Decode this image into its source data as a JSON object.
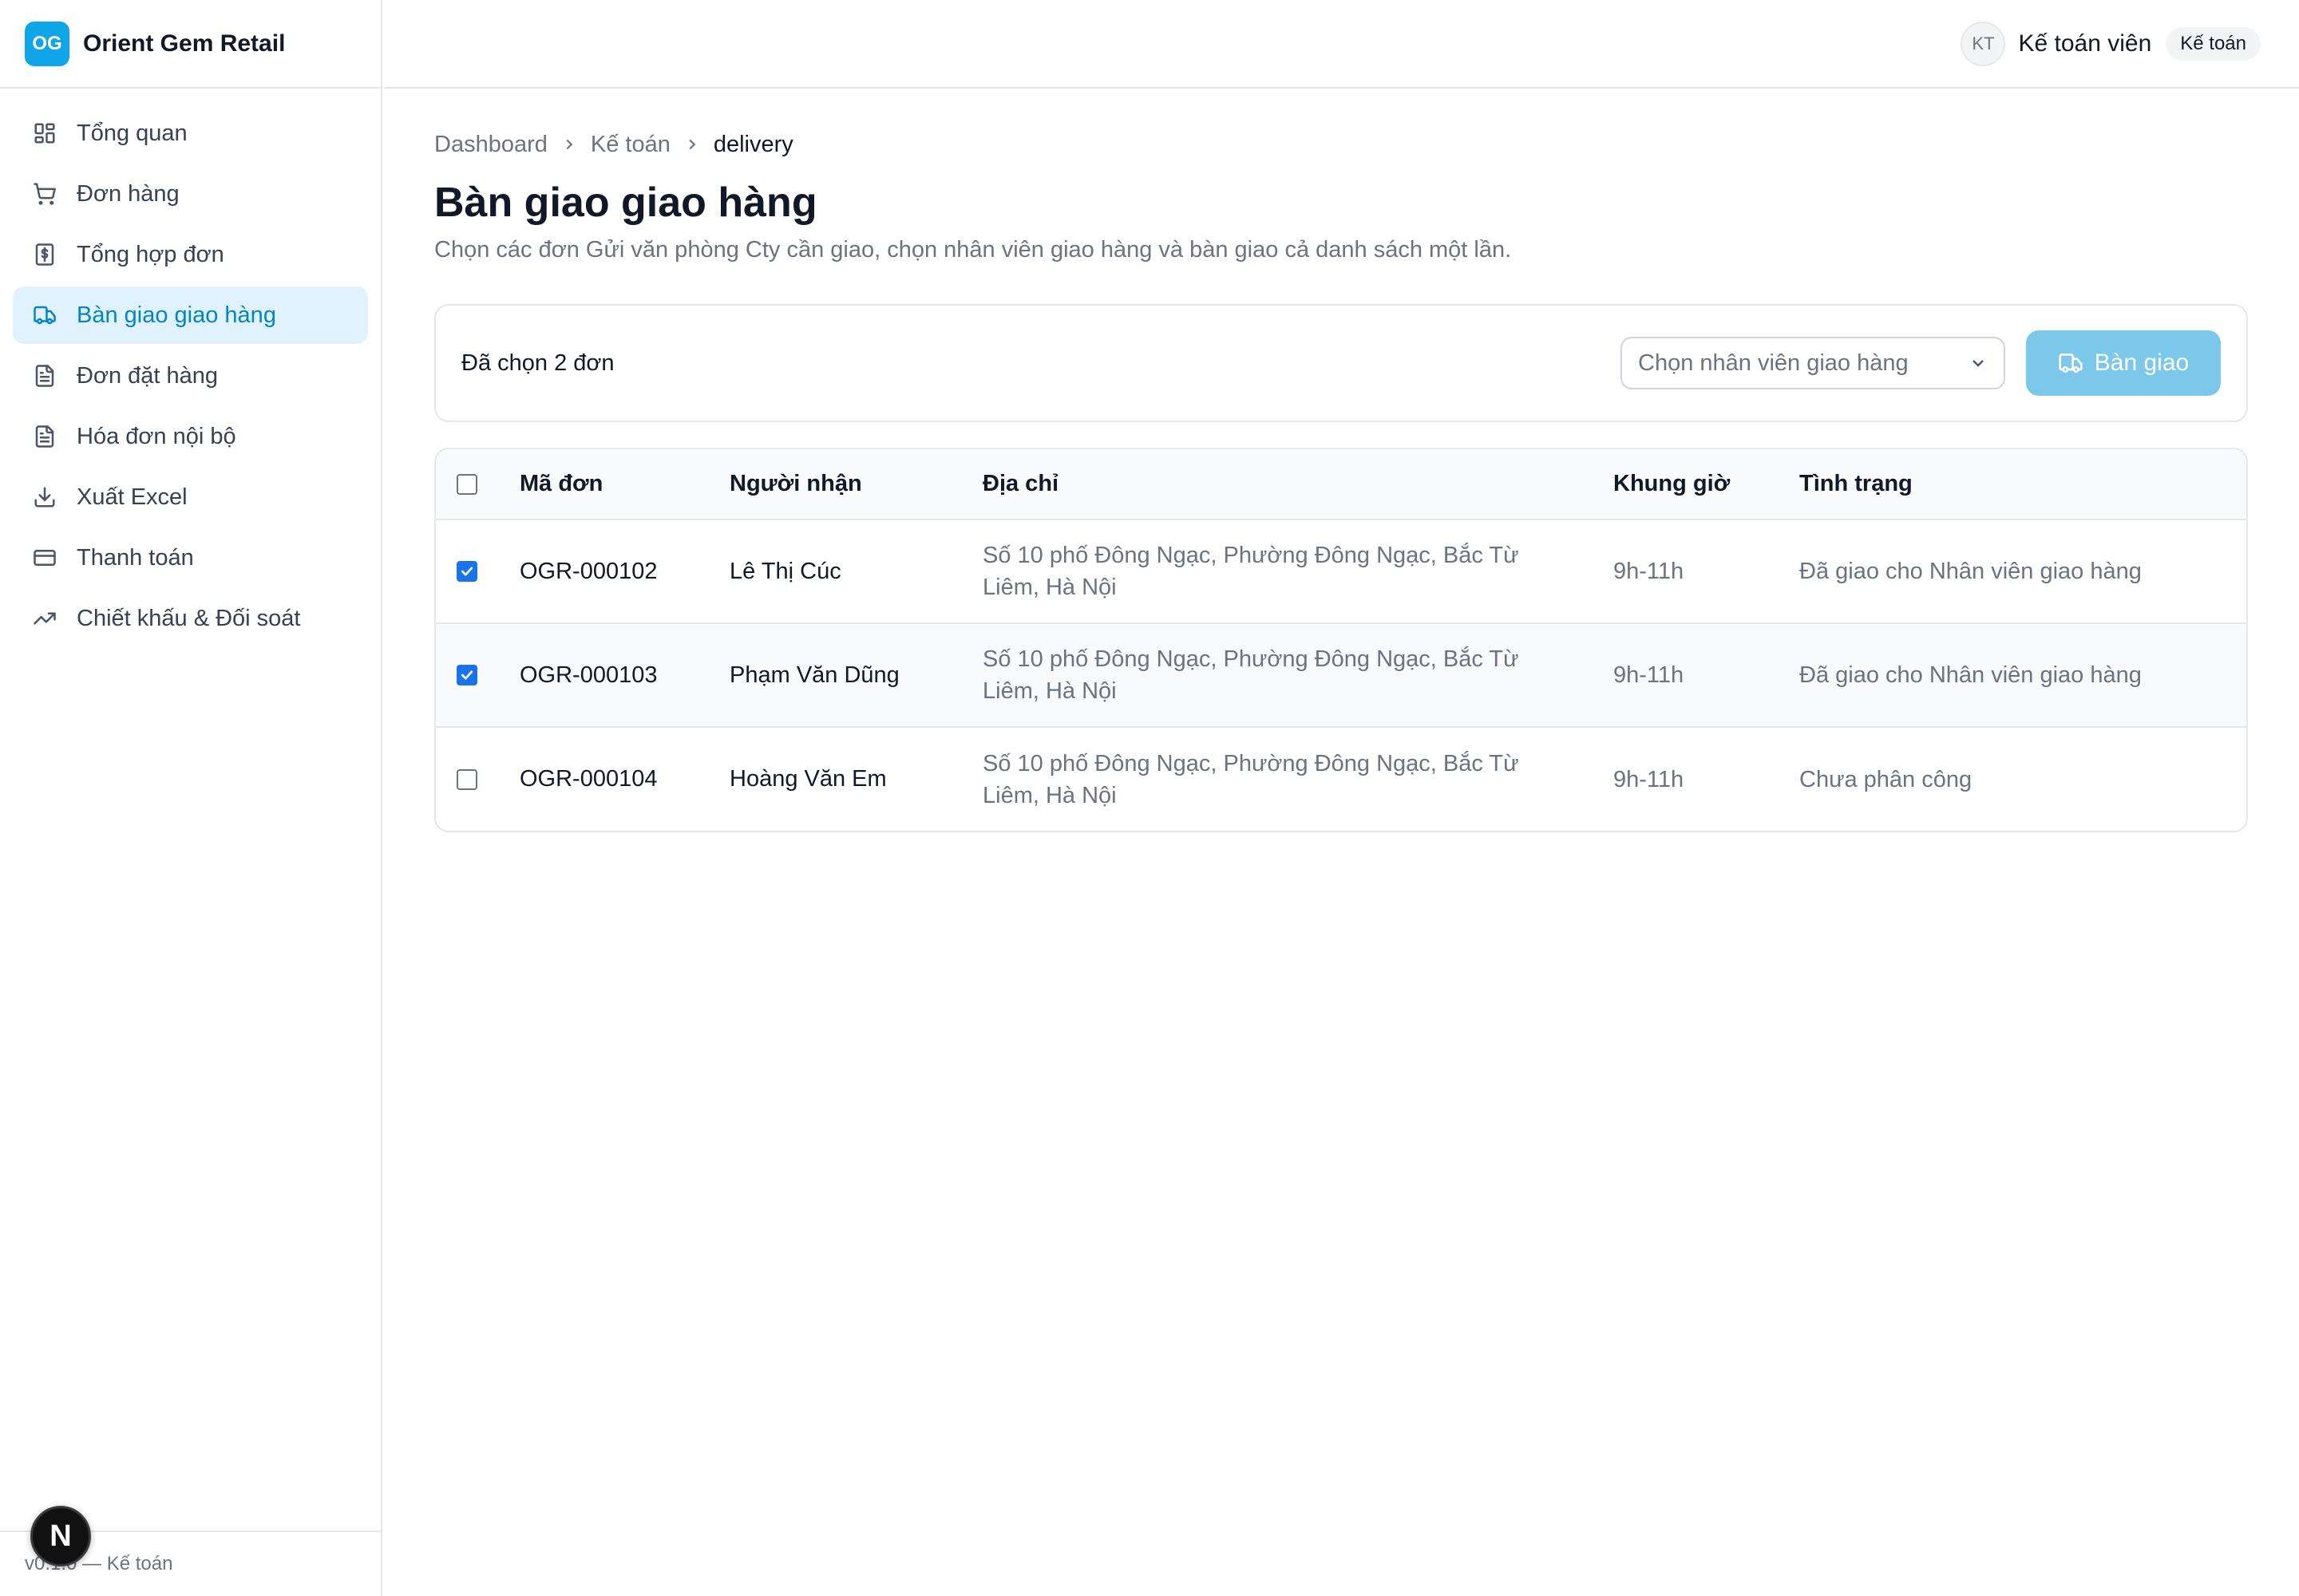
{
  "brand": {
    "logo": "OG",
    "name": "Orient Gem Retail"
  },
  "sidebar": {
    "items": [
      {
        "label": "Tổng quan",
        "icon": "dashboard-icon",
        "active": false
      },
      {
        "label": "Đơn hàng",
        "icon": "cart-icon",
        "active": false
      },
      {
        "label": "Tổng hợp đơn",
        "icon": "receipt-icon",
        "active": false
      },
      {
        "label": "Bàn giao giao hàng",
        "icon": "truck-icon",
        "active": true
      },
      {
        "label": "Đơn đặt hàng",
        "icon": "document-icon",
        "active": false
      },
      {
        "label": "Hóa đơn nội bộ",
        "icon": "document-icon",
        "active": false
      },
      {
        "label": "Xuất Excel",
        "icon": "download-icon",
        "active": false
      },
      {
        "label": "Thanh toán",
        "icon": "card-icon",
        "active": false
      },
      {
        "label": "Chiết khấu & Đối soát",
        "icon": "trend-icon",
        "active": false
      }
    ],
    "footer": "v0.1.0 — Kế toán",
    "next_badge": "N"
  },
  "header": {
    "avatar": "KT",
    "user_name": "Kế toán viên",
    "role": "Kế toán"
  },
  "breadcrumb": [
    "Dashboard",
    "Kế toán",
    "delivery"
  ],
  "page": {
    "title": "Bàn giao giao hàng",
    "description": "Chọn các đơn Gửi văn phòng Cty cần giao, chọn nhân viên giao hàng và bàn giao cả danh sách một lần."
  },
  "actions": {
    "selected_count": "Đã chọn 2 đơn",
    "shipper_placeholder": "Chọn nhân viên giao hàng",
    "handover_label": "Bàn giao"
  },
  "table": {
    "columns": [
      "Mã đơn",
      "Người nhận",
      "Địa chỉ",
      "Khung giờ",
      "Tình trạng"
    ],
    "rows": [
      {
        "checked": true,
        "code": "OGR-000102",
        "recipient": "Lê Thị Cúc",
        "address": "Số 10 phố Đông Ngạc, Phường Đông Ngạc, Bắc Từ Liêm, Hà Nội",
        "time": "9h-11h",
        "status": "Đã giao cho Nhân viên giao hàng"
      },
      {
        "checked": true,
        "code": "OGR-000103",
        "recipient": "Phạm Văn Dũng",
        "address": "Số 10 phố Đông Ngạc, Phường Đông Ngạc, Bắc Từ Liêm, Hà Nội",
        "time": "9h-11h",
        "status": "Đã giao cho Nhân viên giao hàng"
      },
      {
        "checked": false,
        "code": "OGR-000104",
        "recipient": "Hoàng Văn Em",
        "address": "Số 10 phố Đông Ngạc, Phường Đông Ngạc, Bắc Từ Liêm, Hà Nội",
        "time": "9h-11h",
        "status": "Chưa phân công"
      }
    ]
  },
  "colors": {
    "accent": "#0284c7",
    "accent_bg": "#e0f2fe",
    "brand": "#0ea5e9",
    "button": "#7cc8ea"
  }
}
